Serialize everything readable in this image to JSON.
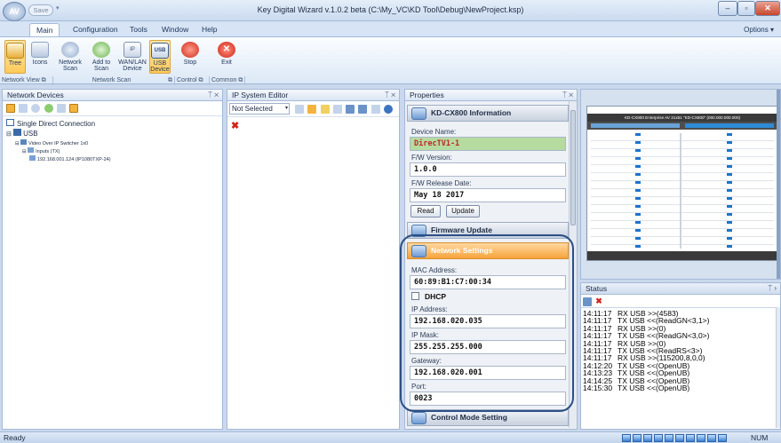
{
  "window": {
    "title": "Key Digital Wizard  v.1.0.2 beta (C:\\My_VC\\KD Tool\\Debug\\NewProject.ksp)",
    "quick_save": "Save",
    "options": "Options"
  },
  "ribbon": {
    "tabs": [
      "Main",
      "Configuration",
      "Tools",
      "Window",
      "Help"
    ],
    "buttons": {
      "tree": "Tree",
      "icons": "Icons",
      "network_scan": [
        "Network",
        "Scan"
      ],
      "add_to_scan": [
        "Add to",
        "Scan"
      ],
      "wan_lan": [
        "WAN/LAN",
        "Device"
      ],
      "usb_device": [
        "USB",
        "Device"
      ],
      "stop": "Stop",
      "exit": "Exit"
    },
    "groups": [
      "Network View",
      "Network Scan",
      "Control",
      "Common"
    ]
  },
  "network_devices": {
    "title": "Network Devices",
    "tree": {
      "root": "Single Direct Connection",
      "usb": "USB",
      "switcher": "Video Over IP Switcher 1x0",
      "inputs": "Inputs (TX)",
      "device": "192.168.001.124 (IP1080TXP-24)"
    }
  },
  "ip_editor": {
    "title": "IP System Editor",
    "select_value": "Not Selected"
  },
  "properties": {
    "title": "Properties",
    "info_title": "KD-CX800 Information",
    "device_name_label": "Device Name:",
    "device_name": "DirecTV1-1",
    "fw_version_label": "F/W Version:",
    "fw_version": "1.0.0",
    "fw_release_label": "F/W Release Date:",
    "fw_release": "May 18 2017",
    "read_btn": "Read",
    "update_btn": "Update",
    "firmware_update": "Firmware Update",
    "network_settings": "Network Settings",
    "mac_label": "MAC Address:",
    "mac": "60:89:B1:C7:00:34",
    "dhcp_label": "DHCP",
    "ip_label": "IP Address:",
    "ip": "192.168.020.035",
    "mask_label": "IP Mask:",
    "mask": "255.255.255.000",
    "gateway_label": "Gateway:",
    "gateway": "192.168.020.001",
    "port_label": "Port:",
    "port": "0023",
    "control_mode": "Control Mode Setting"
  },
  "preview": {
    "header": "KD-CX800 Enterprise AV 21x51 \"KD-CX800\" (000.000.000.000)"
  },
  "status": {
    "title": "Status",
    "log": [
      {
        "t": "14:11:17",
        "m": "RX USB >>(4583)"
      },
      {
        "t": "14:11:17",
        "m": "TX USB <<(ReadGN<3,1>)"
      },
      {
        "t": "14:11:17",
        "m": "RX USB >>(0)"
      },
      {
        "t": "14:11:17",
        "m": "TX USB <<(ReadGN<3,0>)"
      },
      {
        "t": "14:11:17",
        "m": "RX USB >>(0)"
      },
      {
        "t": "14:11:17",
        "m": "TX USB <<(ReadRS<3>)"
      },
      {
        "t": "14:11:17",
        "m": "RX USB >>(115200,8,0,0)"
      },
      {
        "t": "14:12:20",
        "m": "TX USB <<(OpenUB)"
      },
      {
        "t": "14:13:23",
        "m": "TX USB <<(OpenUB)"
      },
      {
        "t": "14:14:25",
        "m": "TX USB <<(OpenUB)"
      },
      {
        "t": "14:15:30",
        "m": "TX USB <<(OpenUB)"
      }
    ]
  },
  "statusbar": {
    "ready": "Ready",
    "num": "NUM"
  },
  "colors": {
    "accent": "#f7a33c",
    "selection_green": "#b6dba0",
    "device_name_red": "#c0262a",
    "highlight_ring": "#2c4f86"
  }
}
